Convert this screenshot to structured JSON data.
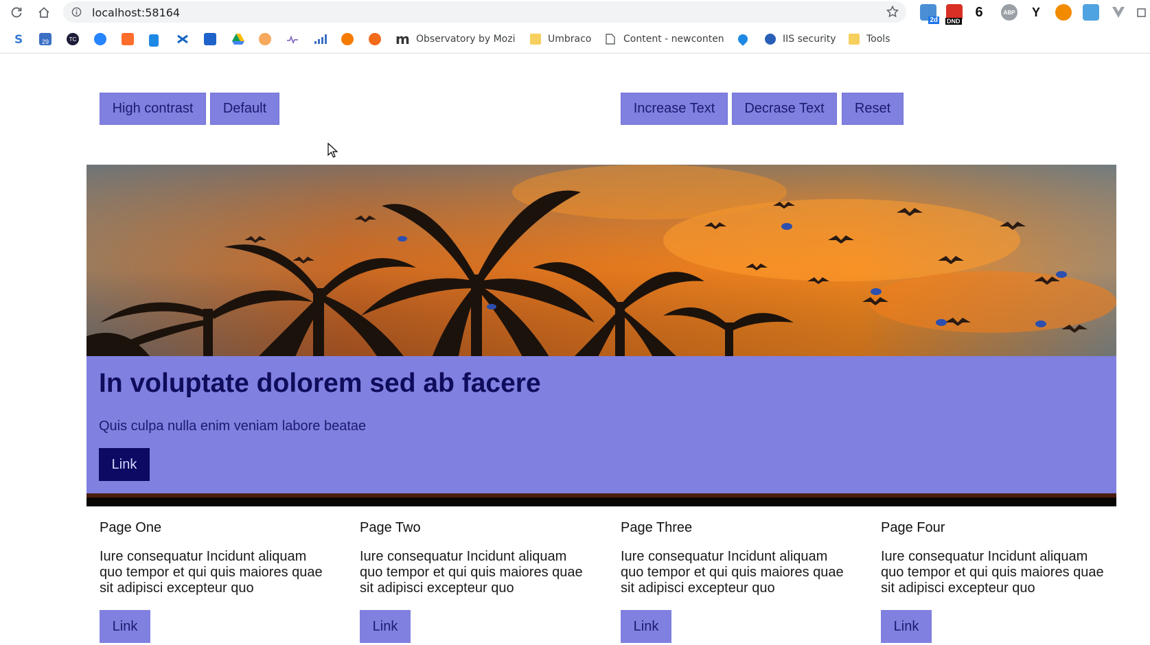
{
  "browser": {
    "url": "localhost:58164",
    "badges": {
      "calendar": "2d",
      "mail": "DND",
      "count": "6",
      "abp": "ABP",
      "y": "Y"
    },
    "bookmarks": [
      {
        "label": "Observatory by Mozi",
        "icon": "m-icon"
      },
      {
        "label": "Umbraco",
        "icon": "folder-icon"
      },
      {
        "label": "Content - newconten",
        "icon": "page-icon"
      },
      {
        "label": "IIS security",
        "icon": "globe-icon"
      },
      {
        "label": "Tools",
        "icon": "folder-icon"
      }
    ],
    "bookmark_icon_text": {
      "calendar": "29",
      "tc": "TC",
      "m": "m"
    }
  },
  "controls": {
    "high_contrast": "High contrast",
    "default": "Default",
    "increase_text": "Increase Text",
    "decrease_text": "Decrase Text",
    "reset": "Reset"
  },
  "hero": {
    "title": "In voluptate dolorem sed ab facere",
    "subtitle": "Quis culpa nulla enim veniam labore beatae",
    "link": "Link"
  },
  "cards": [
    {
      "title": "Page One",
      "body": "Iure consequatur Incidunt aliquam quo tempor et qui quis maiores quae sit adipisci excepteur quo",
      "link": "Link"
    },
    {
      "title": "Page Two",
      "body": "Iure consequatur Incidunt aliquam quo tempor et qui quis maiores quae sit adipisci excepteur quo",
      "link": "Link"
    },
    {
      "title": "Page Three",
      "body": "Iure consequatur Incidunt aliquam quo tempor et qui quis maiores quae sit adipisci excepteur quo",
      "link": "Link"
    },
    {
      "title": "Page Four",
      "body": "Iure consequatur Incidunt aliquam quo tempor et qui quis maiores quae sit adipisci excepteur quo",
      "link": "Link"
    }
  ],
  "colors": {
    "accent": "#8080e0",
    "accent_text": "#1c1a6e",
    "dark_button": "#0c0a62",
    "title": "#0f0c5c"
  }
}
